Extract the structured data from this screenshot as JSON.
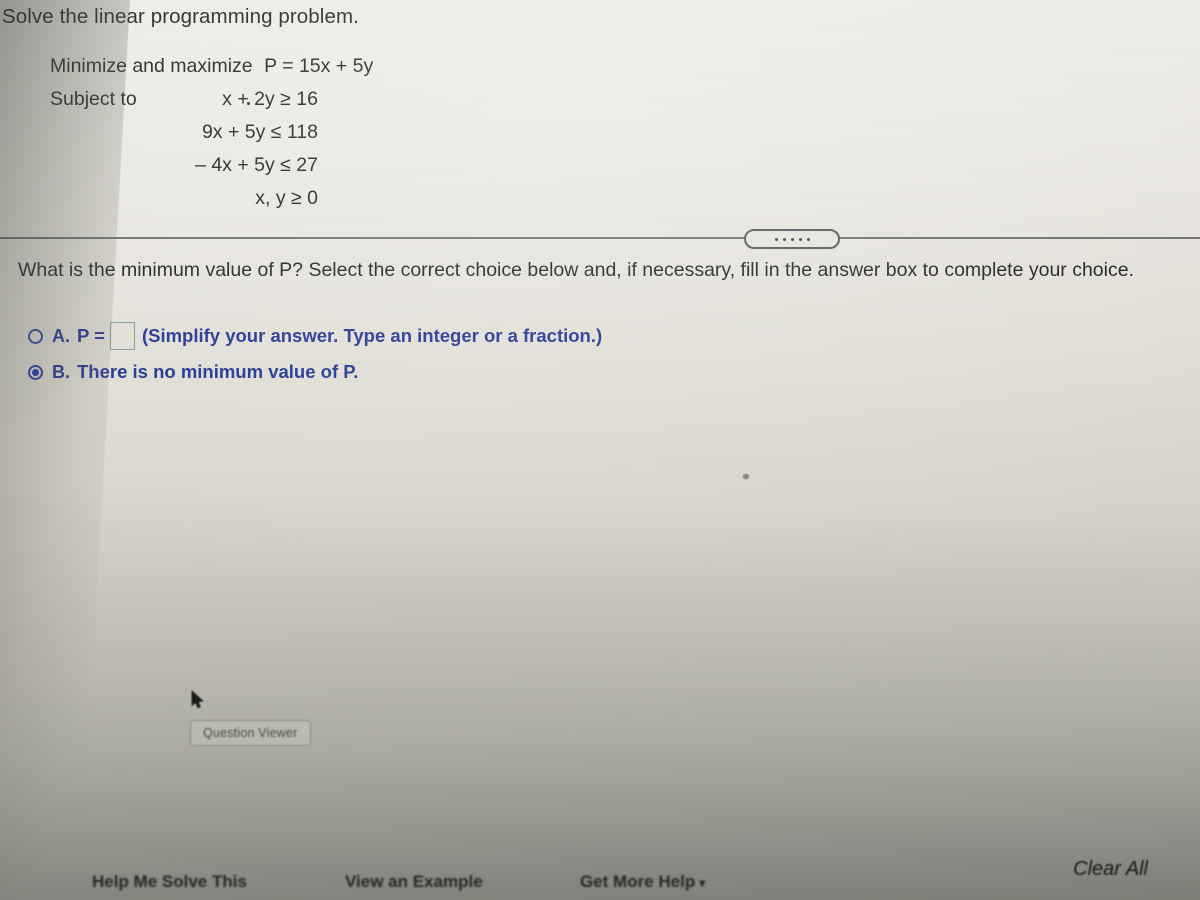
{
  "page": {
    "title": "Solve the linear programming problem."
  },
  "problem": {
    "objective_label": "Minimize and maximize",
    "objective": "P = 15x + 5y",
    "subject_to_label": "Subject to",
    "constraints": [
      "x + 2y  ≥  16",
      "9x + 5y  ≤  118",
      "– 4x + 5y  ≤  27",
      "x, y  ≥  0"
    ],
    "constraint_1_lhs": "x + 2y",
    "constraint_1_rel": "≥",
    "constraint_1_rhs": "16",
    "constraint_2_lhs": "9x + 5y",
    "constraint_2_rel": "≤",
    "constraint_2_rhs": "118",
    "constraint_3_lhs": "– 4x + 5y",
    "constraint_3_rel": "≤",
    "constraint_3_rhs": "27",
    "constraint_4_lhs": "x, y",
    "constraint_4_rel": "≥",
    "constraint_4_rhs": "0"
  },
  "divider": {
    "collapse_handle_name": "collapse-handle",
    "dot_count": 5
  },
  "question": {
    "text": "What is the minimum value of P? Select the correct choice below and, if necessary, fill in the answer box to complete your choice."
  },
  "choices": [
    {
      "letter": "A.",
      "prefix": "P =",
      "input_value": "",
      "input_placeholder": "",
      "hint": "(Simplify your answer. Type an integer or a fraction.)",
      "selected": false
    },
    {
      "letter": "B.",
      "text": "There is no minimum value of P.",
      "selected": true
    }
  ],
  "question_viewer": {
    "label": "Question Viewer"
  },
  "toolbar": {
    "help_me_solve_this": "Help Me Solve This",
    "view_an_example": "View an Example",
    "get_more_help": "Get More Help",
    "get_more_help_caret": "▾",
    "clear_all": "Clear All"
  },
  "colors": {
    "text": "#18181a",
    "choice_blue": "#1b2f8e",
    "radio_blue": "#1430b4",
    "divider": "#4e4e52",
    "answer_box_border": "#7e9b94",
    "background_top": "#efeee8",
    "background_bottom": "#95948d"
  }
}
